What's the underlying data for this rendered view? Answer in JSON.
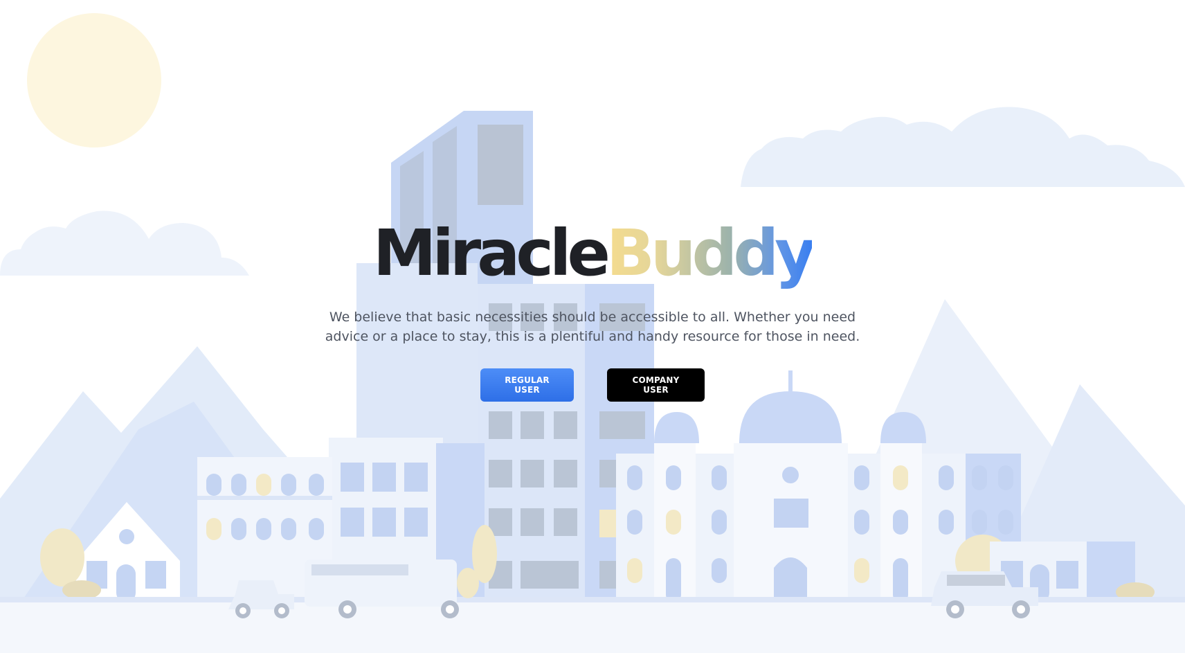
{
  "hero": {
    "title_part1": "Miracle",
    "title_part2": "Buddy",
    "tagline": "We believe that basic necessities should be accessible to all. Whether you need advice or a place to stay, this is a plentiful and handy resource for those in need."
  },
  "actions": {
    "regular_label": "REGULAR USER",
    "company_label": "COMPANY USER"
  },
  "colors": {
    "regular_button": "#3a7ff0",
    "company_button": "#000000",
    "title_dark": "#1f2126",
    "sun": "#fdf6df",
    "city": "#c9d8f6"
  }
}
